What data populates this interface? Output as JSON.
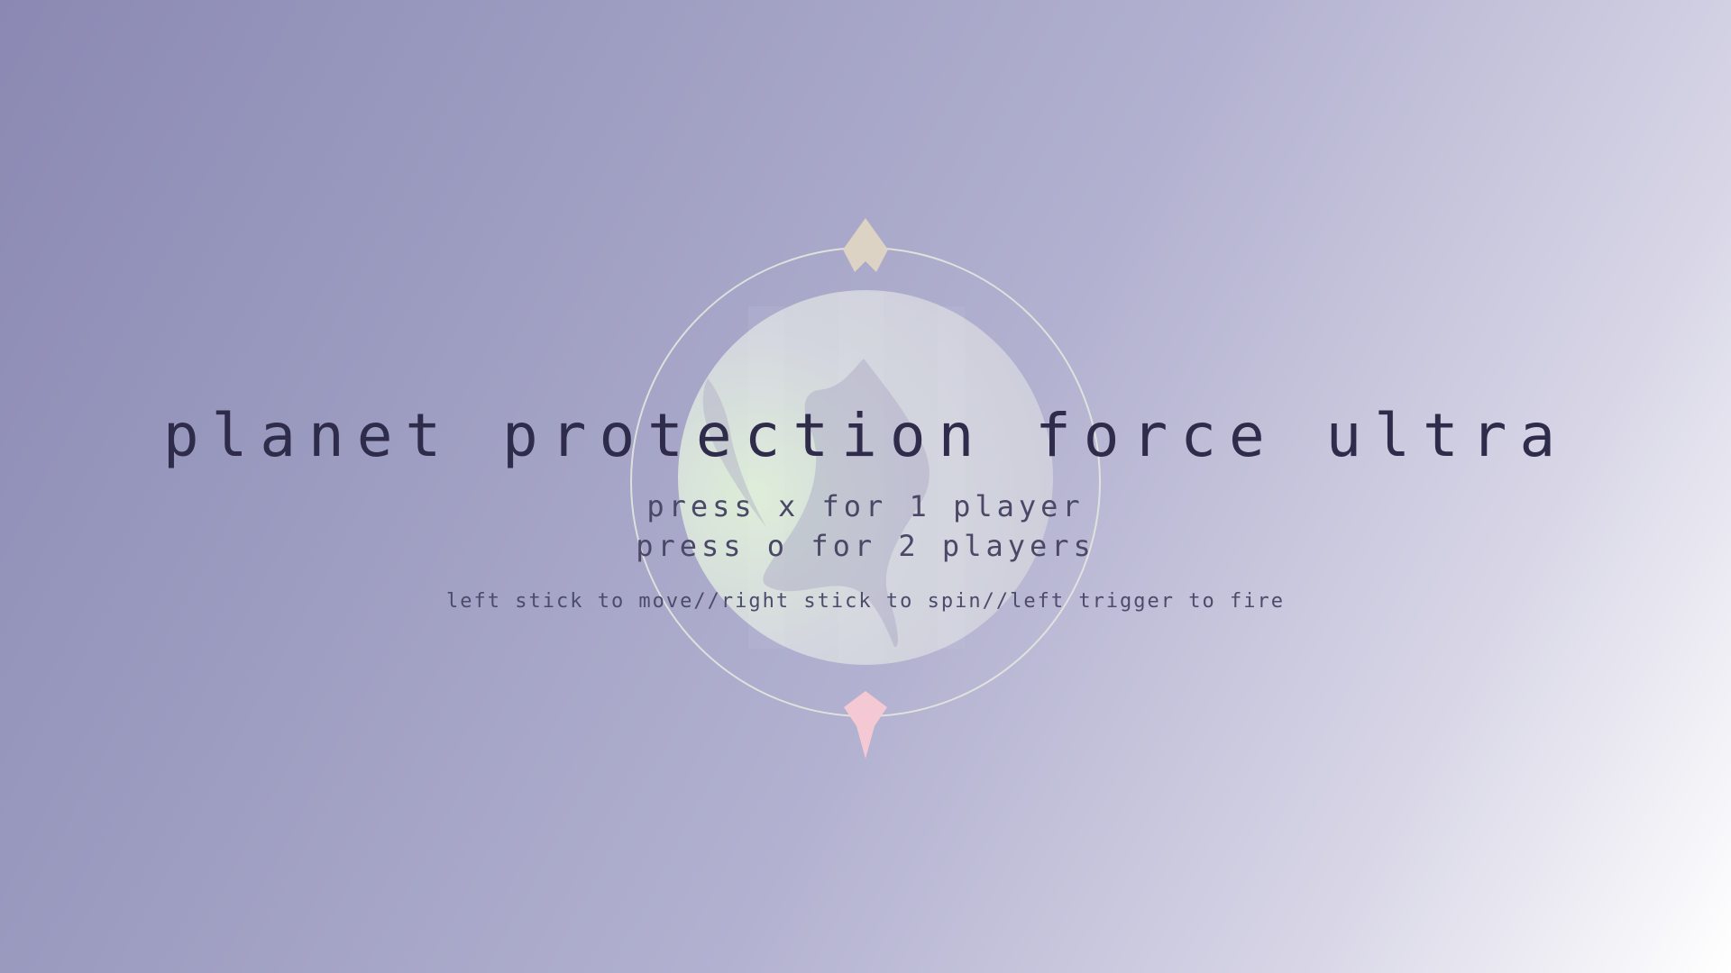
{
  "title": "planet protection force ultra",
  "menu": {
    "one_player": "press x for 1 player",
    "two_players": "press o for 2 players"
  },
  "controls": {
    "move": "left stick to move ",
    "sep1": "//",
    "spin": "right stick to spin ",
    "sep2": "//",
    "fire": "left trigger to fire"
  },
  "colors": {
    "background_start": "#8b89b3",
    "background_end": "#ffffff",
    "planet_fill": "#d4d6df",
    "planet_glow": "#dff0d8",
    "orbit_ring": "#e3e8df",
    "ship_player1": "#dcd3c4",
    "ship_player2": "#f4c9d3",
    "title_text": "#2e2c4a"
  },
  "icons": {
    "planet": "planet-icon",
    "orbit": "orbit-ring",
    "ship_top": "ship-player1-icon",
    "ship_bottom": "ship-player2-icon"
  }
}
